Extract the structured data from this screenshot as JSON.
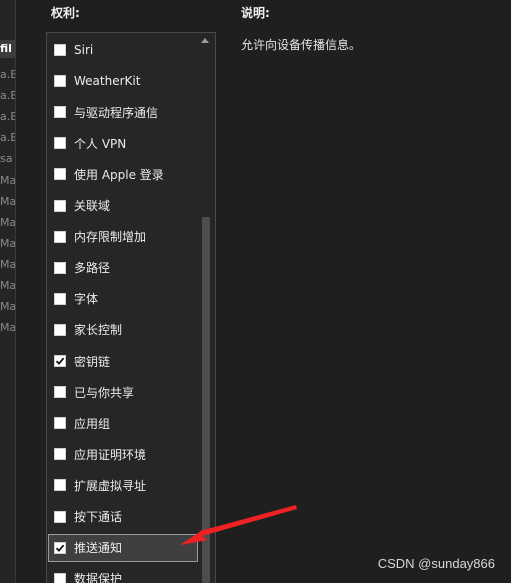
{
  "left_panel": {
    "items": [
      "fil",
      "a.B",
      "a.B",
      "a.B",
      "a.B",
      "sa",
      "Ma",
      "Ma",
      "Ma",
      "Ma",
      "Ma",
      "Ma",
      "Ma",
      "Ma"
    ]
  },
  "entitlements": {
    "header": "权利:",
    "items": [
      {
        "label": "Siri",
        "checked": false
      },
      {
        "label": "WeatherKit",
        "checked": false
      },
      {
        "label": "与驱动程序通信",
        "checked": false
      },
      {
        "label": "个人 VPN",
        "checked": false
      },
      {
        "label": "使用 Apple 登录",
        "checked": false
      },
      {
        "label": "关联域",
        "checked": false
      },
      {
        "label": "内存限制增加",
        "checked": false
      },
      {
        "label": "多路径",
        "checked": false
      },
      {
        "label": "字体",
        "checked": false
      },
      {
        "label": "家长控制",
        "checked": false
      },
      {
        "label": "密钥链",
        "checked": true
      },
      {
        "label": "已与你共享",
        "checked": false
      },
      {
        "label": "应用组",
        "checked": false
      },
      {
        "label": "应用证明环境",
        "checked": false
      },
      {
        "label": "扩展虚拟寻址",
        "checked": false
      },
      {
        "label": "按下通话",
        "checked": false
      },
      {
        "label": "推送通知",
        "checked": true
      },
      {
        "label": "数据保护",
        "checked": false
      }
    ]
  },
  "description": {
    "header": "说明:",
    "text": "允许向设备传播信息。"
  },
  "annotation": {
    "arrow_color": "#ee2222"
  },
  "watermark": "CSDN @sunday866"
}
